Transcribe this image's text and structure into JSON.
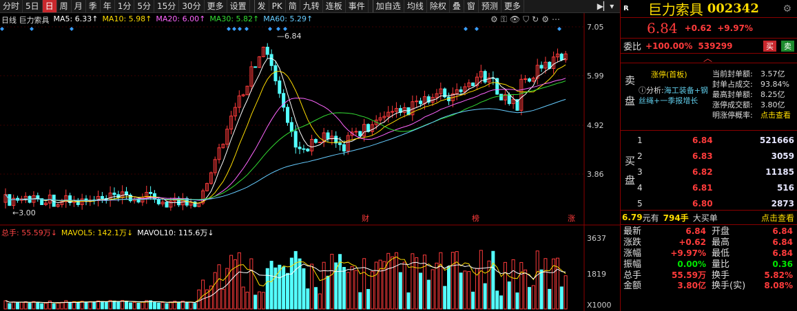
{
  "toolbar": {
    "items": [
      "分时",
      "5日",
      "日",
      "周",
      "月",
      "季",
      "年",
      "1分",
      "5分",
      "15分",
      "30分",
      "更多",
      "设置",
      "发",
      "PK",
      "简",
      "九转",
      "连板",
      "事件",
      "加自选",
      "均线",
      "除权",
      "叠",
      "窗",
      "预测",
      "更多"
    ],
    "active_index": 2,
    "end_arrows": "▶▏▾"
  },
  "chart": {
    "stock_label": "日线  巨力索具",
    "ma": [
      {
        "label": "MA5: 6.33↑",
        "color": "#ffffff"
      },
      {
        "label": "MA10: 5.98↑",
        "color": "#ffdd00"
      },
      {
        "label": "MA20: 6.00↑",
        "color": "#ff66ff"
      },
      {
        "label": "MA30: 5.82↑",
        "color": "#33dd33"
      },
      {
        "label": "MA60: 5.29↑",
        "color": "#66ccff"
      }
    ],
    "price_ticks": [
      "7.05",
      "5.99",
      "4.92",
      "3.86"
    ],
    "high_marker": "6.84",
    "low_marker": "3.00",
    "event_labels": [
      "财",
      "榜",
      "涨"
    ],
    "volume_legend": [
      {
        "label": "总手: 55.59万↓",
        "color": "#ff4444"
      },
      {
        "label": "MAVOL5: 142.1万↓",
        "color": "#ffdd00"
      },
      {
        "label": "MAVOL10: 115.6万↓",
        "color": "#ffffff"
      }
    ],
    "volume_ticks": [
      "3637",
      "1819",
      "X1000"
    ],
    "icons": [
      "gear-icon",
      "eye-icon",
      "shield-icon",
      "lock-icon",
      "refresh-icon",
      "settings-icon",
      "dots-icon"
    ]
  },
  "header": {
    "flag": "R",
    "name": "巨力索具",
    "code": "002342",
    "price": "6.84",
    "change": "+0.62",
    "pct": "+9.97%"
  },
  "weibi": {
    "label": "委比",
    "pct": "+100.00%",
    "vol": "539299",
    "sell_btn": "买",
    "buy_btn": "卖"
  },
  "sell": {
    "label": "卖盘",
    "tag": "涨停(首板)",
    "analysis_label": "ⓘ分析:",
    "analysis_text": "海工装备+钢丝绳+一季报增长",
    "stats": [
      {
        "k": "当前封单额:",
        "v": "3.57亿"
      },
      {
        "k": "封单占成交:",
        "v": "93.84%"
      },
      {
        "k": "最高封单额:",
        "v": "8.25亿"
      },
      {
        "k": "涨停成交额:",
        "v": "3.80亿"
      },
      {
        "k": "明涨停概率:",
        "v": "点击查看"
      }
    ]
  },
  "buy": {
    "label": "买盘",
    "rows": [
      {
        "n": "1",
        "p": "6.84",
        "v": "521666"
      },
      {
        "n": "2",
        "p": "6.83",
        "v": "3059"
      },
      {
        "n": "3",
        "p": "6.82",
        "v": "11185"
      },
      {
        "n": "4",
        "p": "6.81",
        "v": "516"
      },
      {
        "n": "5",
        "p": "6.80",
        "v": "2873"
      }
    ]
  },
  "bigorder": {
    "price": "6.79",
    "unit1": "元有",
    "vol": "794手",
    "text": "大买单",
    "link": "点击查看"
  },
  "quote": [
    {
      "k1": "最新",
      "v1": "6.84",
      "k2": "开盘",
      "v2": "6.84"
    },
    {
      "k1": "涨跌",
      "v1": "+0.62",
      "k2": "最高",
      "v2": "6.84"
    },
    {
      "k1": "涨幅",
      "v1": "+9.97%",
      "k2": "最低",
      "v2": "6.84"
    },
    {
      "k1": "振幅",
      "v1": "0.00%",
      "k2": "量比",
      "v2": "0.36"
    },
    {
      "k1": "总手",
      "v1": "55.59万",
      "k2": "换手",
      "v2": "5.82%"
    },
    {
      "k1": "金额",
      "v1": "3.80亿",
      "k2": "换手(实)",
      "v2": "8.08%"
    }
  ]
}
